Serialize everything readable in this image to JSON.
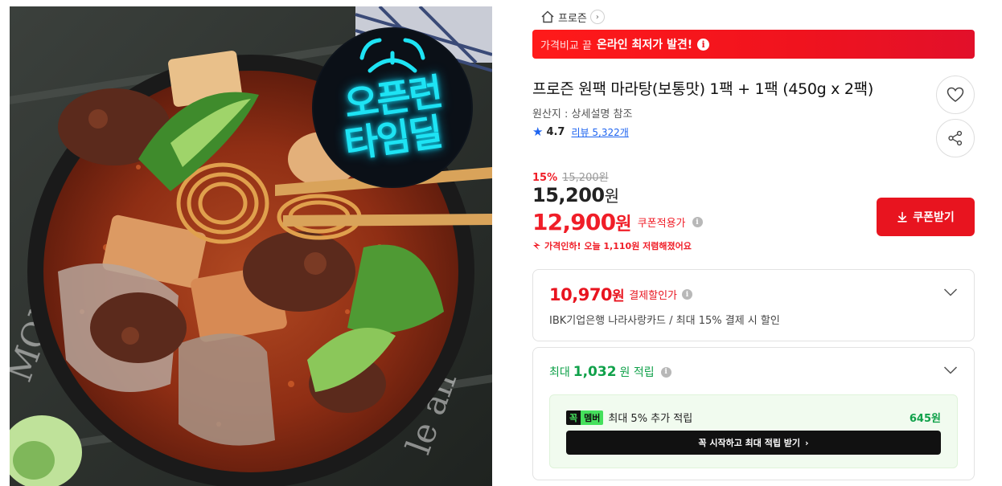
{
  "image": {
    "badge_line1": "오픈런",
    "badge_line2": "타임딜",
    "badge_color": "#1ee3f4"
  },
  "breadcrumb": {
    "home_icon": "home-icon",
    "category": "프로즌",
    "chevron": "›"
  },
  "promo": {
    "prefix": "가격비교 끝",
    "highlight": "온라인 최저가 발견!",
    "info": "i",
    "color": "#f0131e"
  },
  "product": {
    "title": "프로즌 원팩 마라탕(보통맛) 1팩 + 1팩 (450g x 2팩)",
    "origin": "원산지 : 상세설명 참조",
    "rating": "4.7",
    "reviews": "리뷰 5,322개"
  },
  "actions": {
    "like_icon": "heart-icon",
    "share_icon": "share-icon"
  },
  "pricing": {
    "discount_rate": "15%",
    "original_price": "15,200원",
    "price_number": "15,200",
    "price_unit": "원",
    "coupon_price_number": "12,900",
    "coupon_price_unit": "원",
    "coupon_label": "쿠폰적용가",
    "drop_note": "가격인하! 오늘 1,110원 저렴해졌어요",
    "accent": "#f01e28"
  },
  "coupon_button": {
    "label": "쿠폰받기"
  },
  "payment": {
    "amount_number": "10,970",
    "amount_unit": "원",
    "label": "결제할인가",
    "description": "IBK기업은행 나라사랑카드 / 최대 15% 결제 시 할인"
  },
  "points": {
    "prefix": "최대",
    "amount": "1,032",
    "suffix": "원 적립",
    "member_badge_a": "꼭",
    "member_badge_b": "멤버",
    "member_text": "최대 5% 추가 적립",
    "member_points": "645원",
    "cta": "꼭 시작하고 최대 적립 받기",
    "cta_chevron": "›",
    "accent": "#10a14a"
  }
}
